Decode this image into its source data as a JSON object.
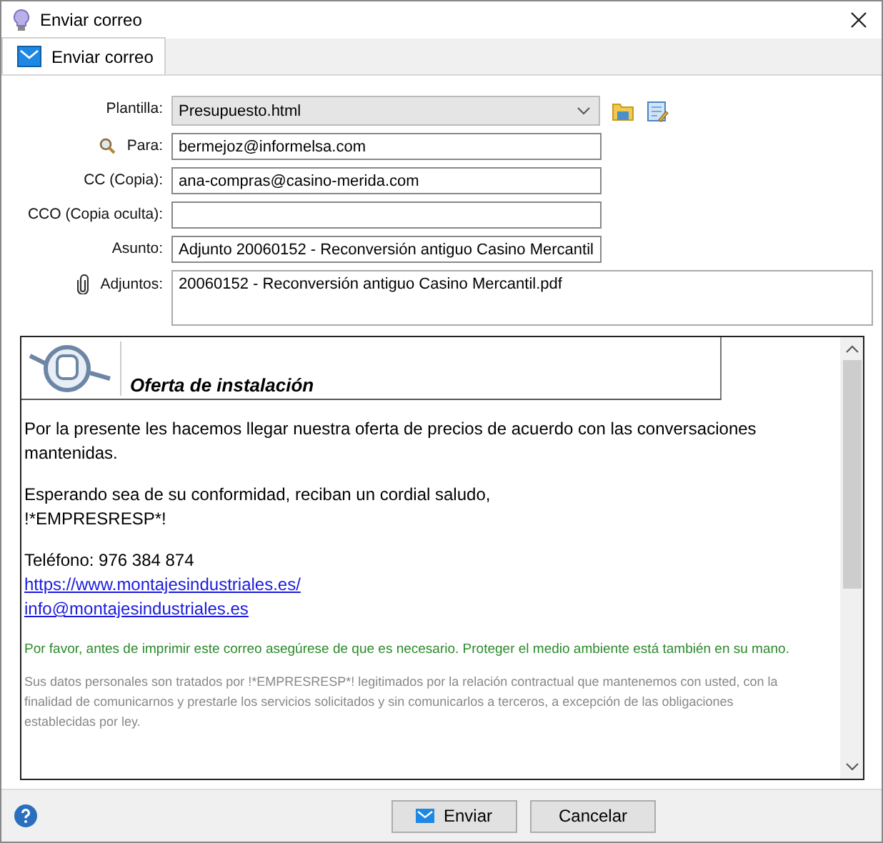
{
  "window": {
    "title": "Enviar correo"
  },
  "tabs": [
    {
      "label": "Enviar correo",
      "selected": true
    }
  ],
  "form": {
    "fields": [
      {
        "kind": "select",
        "label": "Plantilla:",
        "value": "Presupuesto.html"
      },
      {
        "kind": "search",
        "label": "Para:",
        "value": "bermejoz@informelsa.com"
      },
      {
        "kind": "text",
        "label": "CC (Copia):",
        "value": "ana-compras@casino-merida.com"
      },
      {
        "kind": "text",
        "label": "CCO (Copia oculta):"
      },
      {
        "kind": "text",
        "label": "Asunto:",
        "value": "Adjunto 20060152 - Reconversión antiguo Casino Mercantil"
      },
      {
        "kind": "attach",
        "label": "Adjuntos:",
        "value": "20060152 - Reconversión antiguo Casino Mercantil.pdf"
      }
    ]
  },
  "message": {
    "heading": "Oferta de instalación",
    "paragraphs": [
      {
        "kind": "text",
        "lines": [
          "Por la presente les hacemos llegar nuestra oferta de precios de acuerdo con las conversaciones mantenidas."
        ]
      },
      {
        "kind": "text",
        "lines": [
          "Esperando sea de su conformidad, reciban un cordial saludo,",
          "!*EMPRESRESP*!"
        ]
      },
      {
        "kind": "contact",
        "lines": [
          "Teléfono: 976 384 874"
        ],
        "links": [
          "https://www.montajesindustriales.es/",
          "info@montajesindustriales.es"
        ]
      },
      {
        "kind": "eco",
        "lines": [
          "Por favor, antes de imprimir este correo asegúrese de que es necesario. Proteger el medio ambiente está también en su mano."
        ]
      },
      {
        "kind": "legal",
        "lines": [
          "Sus datos personales son tratados por !*EMPRESRESP*! legitimados por la relación contractual que mantenemos con usted, con la finalidad de comunicarnos y prestarle los servicios solicitados y sin comunicarlos a terceros, a excepción de las obligaciones establecidas por ley."
        ]
      }
    ]
  },
  "buttons": [
    {
      "kind": "send",
      "label": "Enviar"
    },
    {
      "kind": "cancel",
      "label": "Cancelar"
    }
  ]
}
